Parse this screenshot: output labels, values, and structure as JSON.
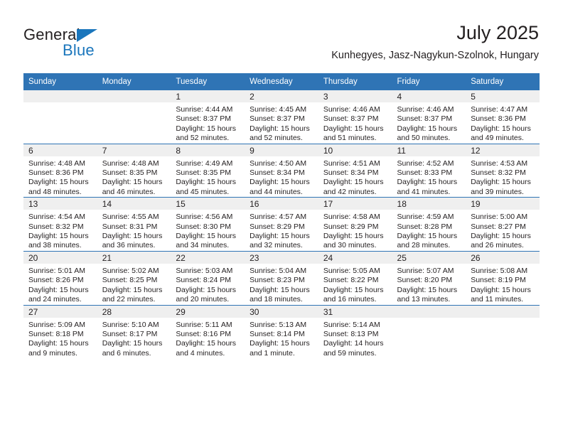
{
  "brand": {
    "name_part1": "General",
    "name_part2": "Blue",
    "logo_icon": "blue-triangle-icon",
    "accent_color": "#1a76bc"
  },
  "header": {
    "title": "July 2025",
    "subtitle": "Kunhegyes, Jasz-Nagykun-Szolnok, Hungary"
  },
  "colors": {
    "header_blue": "#2f74b5",
    "daynum_band": "#efefef",
    "text": "#231f20"
  },
  "calendar": {
    "weekday_headers": [
      "Sunday",
      "Monday",
      "Tuesday",
      "Wednesday",
      "Thursday",
      "Friday",
      "Saturday"
    ],
    "weeks": [
      [
        {
          "day": "",
          "sunrise": "",
          "sunset": "",
          "daylight1": "",
          "daylight2": ""
        },
        {
          "day": "",
          "sunrise": "",
          "sunset": "",
          "daylight1": "",
          "daylight2": ""
        },
        {
          "day": "1",
          "sunrise": "Sunrise: 4:44 AM",
          "sunset": "Sunset: 8:37 PM",
          "daylight1": "Daylight: 15 hours",
          "daylight2": "and 52 minutes."
        },
        {
          "day": "2",
          "sunrise": "Sunrise: 4:45 AM",
          "sunset": "Sunset: 8:37 PM",
          "daylight1": "Daylight: 15 hours",
          "daylight2": "and 52 minutes."
        },
        {
          "day": "3",
          "sunrise": "Sunrise: 4:46 AM",
          "sunset": "Sunset: 8:37 PM",
          "daylight1": "Daylight: 15 hours",
          "daylight2": "and 51 minutes."
        },
        {
          "day": "4",
          "sunrise": "Sunrise: 4:46 AM",
          "sunset": "Sunset: 8:37 PM",
          "daylight1": "Daylight: 15 hours",
          "daylight2": "and 50 minutes."
        },
        {
          "day": "5",
          "sunrise": "Sunrise: 4:47 AM",
          "sunset": "Sunset: 8:36 PM",
          "daylight1": "Daylight: 15 hours",
          "daylight2": "and 49 minutes."
        }
      ],
      [
        {
          "day": "6",
          "sunrise": "Sunrise: 4:48 AM",
          "sunset": "Sunset: 8:36 PM",
          "daylight1": "Daylight: 15 hours",
          "daylight2": "and 48 minutes."
        },
        {
          "day": "7",
          "sunrise": "Sunrise: 4:48 AM",
          "sunset": "Sunset: 8:35 PM",
          "daylight1": "Daylight: 15 hours",
          "daylight2": "and 46 minutes."
        },
        {
          "day": "8",
          "sunrise": "Sunrise: 4:49 AM",
          "sunset": "Sunset: 8:35 PM",
          "daylight1": "Daylight: 15 hours",
          "daylight2": "and 45 minutes."
        },
        {
          "day": "9",
          "sunrise": "Sunrise: 4:50 AM",
          "sunset": "Sunset: 8:34 PM",
          "daylight1": "Daylight: 15 hours",
          "daylight2": "and 44 minutes."
        },
        {
          "day": "10",
          "sunrise": "Sunrise: 4:51 AM",
          "sunset": "Sunset: 8:34 PM",
          "daylight1": "Daylight: 15 hours",
          "daylight2": "and 42 minutes."
        },
        {
          "day": "11",
          "sunrise": "Sunrise: 4:52 AM",
          "sunset": "Sunset: 8:33 PM",
          "daylight1": "Daylight: 15 hours",
          "daylight2": "and 41 minutes."
        },
        {
          "day": "12",
          "sunrise": "Sunrise: 4:53 AM",
          "sunset": "Sunset: 8:32 PM",
          "daylight1": "Daylight: 15 hours",
          "daylight2": "and 39 minutes."
        }
      ],
      [
        {
          "day": "13",
          "sunrise": "Sunrise: 4:54 AM",
          "sunset": "Sunset: 8:32 PM",
          "daylight1": "Daylight: 15 hours",
          "daylight2": "and 38 minutes."
        },
        {
          "day": "14",
          "sunrise": "Sunrise: 4:55 AM",
          "sunset": "Sunset: 8:31 PM",
          "daylight1": "Daylight: 15 hours",
          "daylight2": "and 36 minutes."
        },
        {
          "day": "15",
          "sunrise": "Sunrise: 4:56 AM",
          "sunset": "Sunset: 8:30 PM",
          "daylight1": "Daylight: 15 hours",
          "daylight2": "and 34 minutes."
        },
        {
          "day": "16",
          "sunrise": "Sunrise: 4:57 AM",
          "sunset": "Sunset: 8:29 PM",
          "daylight1": "Daylight: 15 hours",
          "daylight2": "and 32 minutes."
        },
        {
          "day": "17",
          "sunrise": "Sunrise: 4:58 AM",
          "sunset": "Sunset: 8:29 PM",
          "daylight1": "Daylight: 15 hours",
          "daylight2": "and 30 minutes."
        },
        {
          "day": "18",
          "sunrise": "Sunrise: 4:59 AM",
          "sunset": "Sunset: 8:28 PM",
          "daylight1": "Daylight: 15 hours",
          "daylight2": "and 28 minutes."
        },
        {
          "day": "19",
          "sunrise": "Sunrise: 5:00 AM",
          "sunset": "Sunset: 8:27 PM",
          "daylight1": "Daylight: 15 hours",
          "daylight2": "and 26 minutes."
        }
      ],
      [
        {
          "day": "20",
          "sunrise": "Sunrise: 5:01 AM",
          "sunset": "Sunset: 8:26 PM",
          "daylight1": "Daylight: 15 hours",
          "daylight2": "and 24 minutes."
        },
        {
          "day": "21",
          "sunrise": "Sunrise: 5:02 AM",
          "sunset": "Sunset: 8:25 PM",
          "daylight1": "Daylight: 15 hours",
          "daylight2": "and 22 minutes."
        },
        {
          "day": "22",
          "sunrise": "Sunrise: 5:03 AM",
          "sunset": "Sunset: 8:24 PM",
          "daylight1": "Daylight: 15 hours",
          "daylight2": "and 20 minutes."
        },
        {
          "day": "23",
          "sunrise": "Sunrise: 5:04 AM",
          "sunset": "Sunset: 8:23 PM",
          "daylight1": "Daylight: 15 hours",
          "daylight2": "and 18 minutes."
        },
        {
          "day": "24",
          "sunrise": "Sunrise: 5:05 AM",
          "sunset": "Sunset: 8:22 PM",
          "daylight1": "Daylight: 15 hours",
          "daylight2": "and 16 minutes."
        },
        {
          "day": "25",
          "sunrise": "Sunrise: 5:07 AM",
          "sunset": "Sunset: 8:20 PM",
          "daylight1": "Daylight: 15 hours",
          "daylight2": "and 13 minutes."
        },
        {
          "day": "26",
          "sunrise": "Sunrise: 5:08 AM",
          "sunset": "Sunset: 8:19 PM",
          "daylight1": "Daylight: 15 hours",
          "daylight2": "and 11 minutes."
        }
      ],
      [
        {
          "day": "27",
          "sunrise": "Sunrise: 5:09 AM",
          "sunset": "Sunset: 8:18 PM",
          "daylight1": "Daylight: 15 hours",
          "daylight2": "and 9 minutes."
        },
        {
          "day": "28",
          "sunrise": "Sunrise: 5:10 AM",
          "sunset": "Sunset: 8:17 PM",
          "daylight1": "Daylight: 15 hours",
          "daylight2": "and 6 minutes."
        },
        {
          "day": "29",
          "sunrise": "Sunrise: 5:11 AM",
          "sunset": "Sunset: 8:16 PM",
          "daylight1": "Daylight: 15 hours",
          "daylight2": "and 4 minutes."
        },
        {
          "day": "30",
          "sunrise": "Sunrise: 5:13 AM",
          "sunset": "Sunset: 8:14 PM",
          "daylight1": "Daylight: 15 hours",
          "daylight2": "and 1 minute."
        },
        {
          "day": "31",
          "sunrise": "Sunrise: 5:14 AM",
          "sunset": "Sunset: 8:13 PM",
          "daylight1": "Daylight: 14 hours",
          "daylight2": "and 59 minutes."
        },
        {
          "day": "",
          "sunrise": "",
          "sunset": "",
          "daylight1": "",
          "daylight2": ""
        },
        {
          "day": "",
          "sunrise": "",
          "sunset": "",
          "daylight1": "",
          "daylight2": ""
        }
      ]
    ]
  }
}
